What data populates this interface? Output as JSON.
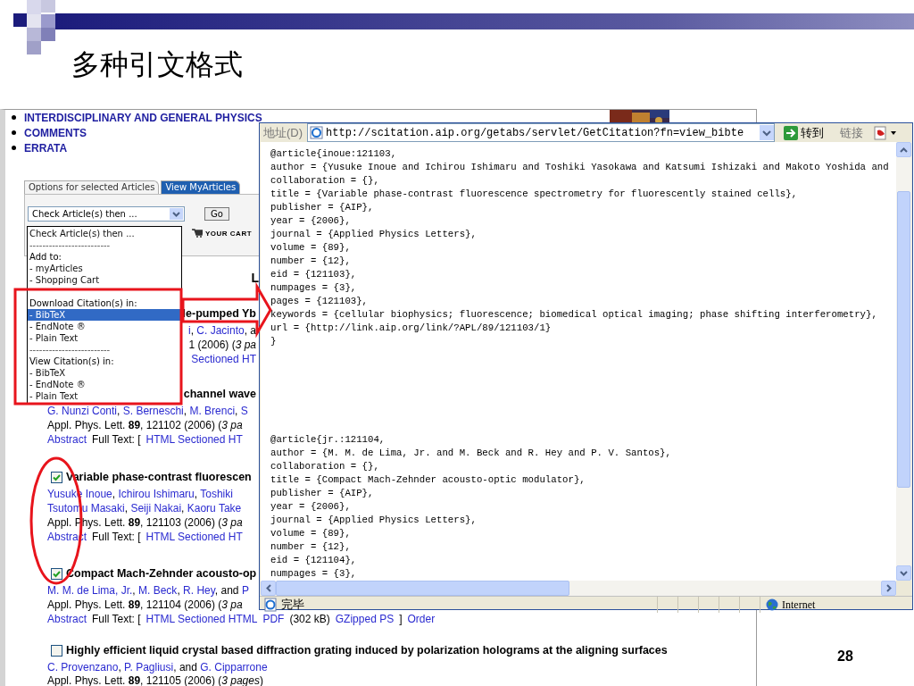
{
  "slide": {
    "title": "多种引文格式",
    "page_number": "28"
  },
  "web_page": {
    "subject_links": [
      "INTERDISCIPLINARY AND GENERAL PHYSICS",
      "COMMENTS",
      "ERRATA"
    ],
    "tabs": [
      {
        "label": "Options for selected Articles",
        "selected": true
      },
      {
        "label": "View MyArticles",
        "selected": false
      }
    ],
    "action_select": {
      "value": "Check Article(s) then ..."
    },
    "go_button": "Go",
    "cart_link": "YOUR CART",
    "heading_fragment": "L",
    "dropdown": {
      "items": [
        {
          "kind": "option",
          "text": "Check Article(s) then ...",
          "selected": false
        },
        {
          "kind": "separator",
          "text": "-------------------------",
          "selected": false
        },
        {
          "kind": "header",
          "text": "Add to:",
          "selected": false
        },
        {
          "kind": "option",
          "text": "- myArticles",
          "selected": false
        },
        {
          "kind": "option",
          "text": "- Shopping Cart",
          "selected": false
        },
        {
          "kind": "spacer"
        },
        {
          "kind": "header",
          "text": "Download Citation(s) in:",
          "selected": false
        },
        {
          "kind": "option",
          "text": "- BibTeX",
          "selected": true
        },
        {
          "kind": "option",
          "text": "- EndNote ®",
          "selected": false
        },
        {
          "kind": "option",
          "text": "- Plain Text",
          "selected": false
        },
        {
          "kind": "separator",
          "text": "-------------------------",
          "selected": false
        },
        {
          "kind": "header",
          "text": "View Citation(s) in:",
          "selected": false
        },
        {
          "kind": "option",
          "text": "- BibTeX",
          "selected": false
        },
        {
          "kind": "option",
          "text": "- EndNote ®",
          "selected": false
        },
        {
          "kind": "option",
          "text": "- Plain Text",
          "selected": false
        }
      ]
    },
    "articles": [
      {
        "title": "le-pumped Yb",
        "title_covered": true,
        "details_covered": true,
        "author_lines": [
          [
            {
              "kind": "link",
              "text": "i"
            },
            {
              "kind": "text",
              "text": ", "
            },
            {
              "kind": "link",
              "text": "C. Jacinto"
            },
            {
              "kind": "text",
              "text": ", a"
            }
          ]
        ],
        "citation": "1 (2006) (*3 pa*",
        "links": [
          {
            "kind": "link",
            "text": "Sectioned HT"
          }
        ]
      },
      {
        "title": "channel wave",
        "title_covered": true,
        "details_covered": false,
        "author_lines": [
          [
            {
              "kind": "link",
              "text": "G. Nunzi Conti"
            },
            {
              "kind": "text",
              "text": ", "
            },
            {
              "kind": "link",
              "text": "S. Berneschi"
            },
            {
              "kind": "text",
              "text": ", "
            },
            {
              "kind": "link",
              "text": "M. Brenci"
            },
            {
              "kind": "text",
              "text": ", "
            },
            {
              "kind": "link",
              "text": "S"
            }
          ]
        ],
        "citation": "Appl. Phys. Lett. **89**, 121102 (2006) (*3 pa*",
        "links": [
          {
            "kind": "link",
            "text": "Abstract"
          },
          {
            "kind": "text",
            "text": "Full Text: ["
          },
          {
            "kind": "link",
            "text": "HTML Sectioned HT"
          }
        ]
      },
      {
        "title": "Variable phase-contrast fluorescen",
        "checked": true,
        "title_covered": false,
        "details_covered": false,
        "author_lines": [
          [
            {
              "kind": "link",
              "text": "Yusuke Inoue"
            },
            {
              "kind": "text",
              "text": ", "
            },
            {
              "kind": "link",
              "text": "Ichirou Ishimaru"
            },
            {
              "kind": "text",
              "text": ", "
            },
            {
              "kind": "link",
              "text": "Toshiki"
            }
          ],
          [
            {
              "kind": "link",
              "text": "Tsutomu Masaki"
            },
            {
              "kind": "text",
              "text": ", "
            },
            {
              "kind": "link",
              "text": "Seiji Nakai"
            },
            {
              "kind": "text",
              "text": ", "
            },
            {
              "kind": "link",
              "text": "Kaoru Take"
            }
          ]
        ],
        "citation": "Appl. Phys. Lett. **89**, 121103 (2006) (*3 pa*",
        "links": [
          {
            "kind": "link",
            "text": "Abstract"
          },
          {
            "kind": "text",
            "text": "Full Text: ["
          },
          {
            "kind": "link",
            "text": "HTML Sectioned HT"
          }
        ]
      },
      {
        "title": "Compact Mach-Zehnder acousto-op",
        "checked": true,
        "title_covered": false,
        "details_covered": false,
        "author_lines": [
          [
            {
              "kind": "link",
              "text": "M. M. de Lima, Jr."
            },
            {
              "kind": "text",
              "text": ", "
            },
            {
              "kind": "link",
              "text": "M. Beck"
            },
            {
              "kind": "text",
              "text": ", "
            },
            {
              "kind": "link",
              "text": "R. Hey"
            },
            {
              "kind": "text",
              "text": ", and "
            },
            {
              "kind": "link",
              "text": "P"
            }
          ]
        ],
        "citation": "Appl. Phys. Lett. **89**, 121104 (2006) (*3 pa*",
        "links": [
          {
            "kind": "link",
            "text": "Abstract"
          },
          {
            "kind": "text",
            "text": "Full Text: ["
          },
          {
            "kind": "link",
            "text": "HTML Sectioned HTML"
          },
          {
            "kind": "link",
            "text": "PDF"
          },
          {
            "kind": "text",
            "text": "(302 kB)"
          },
          {
            "kind": "link",
            "text": "GZipped PS"
          },
          {
            "kind": "text",
            "text": "]"
          },
          {
            "kind": "link",
            "text": "Order"
          }
        ]
      },
      {
        "title": "Highly efficient liquid crystal based diffraction grating induced by polarization holograms at the aligning surfaces",
        "checked": false,
        "title_covered": false,
        "details_covered": false,
        "author_lines": [
          [
            {
              "kind": "link",
              "text": "C. Provenzano"
            },
            {
              "kind": "text",
              "text": ", "
            },
            {
              "kind": "link",
              "text": "P. Pagliusi"
            },
            {
              "kind": "text",
              "text": ", and "
            },
            {
              "kind": "link",
              "text": "G. Cipparrone"
            }
          ]
        ],
        "citation": "Appl. Phys. Lett. **89**, 121105 (2006) (*3 pages*)"
      }
    ]
  },
  "browser": {
    "address_label": "地址(D)",
    "url": "http://scitation.aip.org/getabs/servlet/GetCitation?fn=view_bibte",
    "go_label": "转到",
    "links_label": "链接",
    "records": [
      {
        "lines": [
          "@article{inoue:121103,",
          "author = {Yusuke Inoue and Ichirou Ishimaru and Toshiki Yasokawa and Katsumi Ishizaki and Makoto Yoshida and",
          "collaboration = {},",
          "title = {Variable phase-contrast fluorescence spectrometry for fluorescently stained cells},",
          "publisher = {AIP},",
          "year = {2006},",
          "journal = {Applied Physics Letters},",
          "volume = {89},",
          "number = {12},",
          "eid = {121103},",
          "numpages = {3},",
          "pages = {121103},",
          "keywords = {cellular biophysics; fluorescence; biomedical optical imaging; phase shifting interferometry},",
          "url = {http://link.aip.org/link/?APL/89/121103/1}",
          "}"
        ]
      },
      {
        "lines": [
          "@article{jr.:121104,",
          "author = {M. M. de Lima, Jr. and M. Beck and R. Hey and P. V. Santos},",
          "collaboration = {},",
          "title = {Compact Mach-Zehnder acousto-optic modulator},",
          "publisher = {AIP},",
          "year = {2006},",
          "journal = {Applied Physics Letters},",
          "volume = {89},",
          "number = {12},",
          "eid = {121104},",
          "numpages = {3},"
        ]
      }
    ],
    "status": "完毕",
    "zone": "Internet"
  }
}
